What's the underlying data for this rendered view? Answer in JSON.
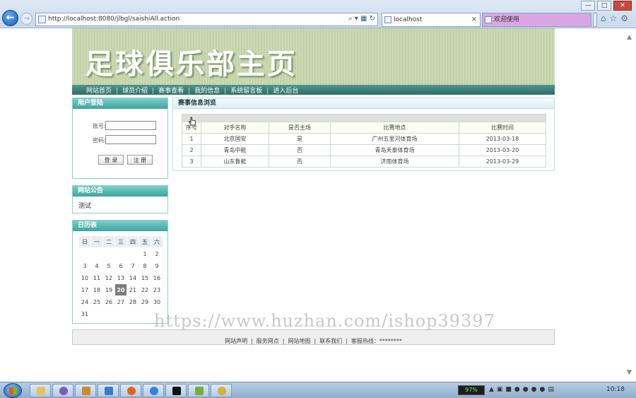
{
  "browser": {
    "url": "http://localhost:8080/jlbgl/saishiAll.action",
    "tabs": [
      {
        "label": "localhost",
        "active": true
      },
      {
        "label": "欢迎使用",
        "active": false
      }
    ],
    "window_buttons": [
      "—",
      "□",
      "✕"
    ]
  },
  "site": {
    "banner_title": "足球俱乐部主页",
    "nav": [
      "网站首页",
      "球员介绍",
      "赛事查看",
      "我的信息",
      "系统留言板",
      "进入后台"
    ]
  },
  "login": {
    "title": "用户登陆",
    "username_label": "账号:",
    "password_label": "密码:",
    "login_button": "登 录",
    "register_button": "注 册"
  },
  "notice": {
    "title": "网站公告",
    "text": "测试"
  },
  "calendar": {
    "title": "日历表",
    "weekdays": [
      "日",
      "一",
      "二",
      "三",
      "四",
      "五",
      "六"
    ],
    "weeks": [
      [
        "",
        "",
        "",
        "",
        "",
        "1",
        "2"
      ],
      [
        "3",
        "4",
        "5",
        "6",
        "7",
        "8",
        "9"
      ],
      [
        "10",
        "11",
        "12",
        "13",
        "14",
        "15",
        "16"
      ],
      [
        "17",
        "18",
        "19",
        "20",
        "21",
        "22",
        "23"
      ],
      [
        "24",
        "25",
        "26",
        "27",
        "28",
        "29",
        "30"
      ],
      [
        "31",
        "",
        "",
        "",
        "",
        "",
        ""
      ]
    ],
    "today": "20"
  },
  "matches": {
    "title": "赛事信息浏览",
    "columns": [
      "序号",
      "对手名称",
      "是否主场",
      "比赛地点",
      "比赛时间"
    ],
    "rows": [
      [
        "1",
        "北京国安",
        "是",
        "广州五里河体育场",
        "2013-03-18"
      ],
      [
        "2",
        "青岛中能",
        "否",
        "青岛天泰体育场",
        "2013-03-20"
      ],
      [
        "3",
        "山东鲁能",
        "否",
        "济南体育场",
        "2013-03-29"
      ]
    ]
  },
  "footer": {
    "links": [
      "网站声明",
      "服务网点",
      "网站地图",
      "联系我们"
    ],
    "hotline": "客服热线：********"
  },
  "watermark": "https://www.huzhan.com/ishop39397",
  "taskbar": {
    "battery": "97%",
    "clock": "10:18"
  }
}
